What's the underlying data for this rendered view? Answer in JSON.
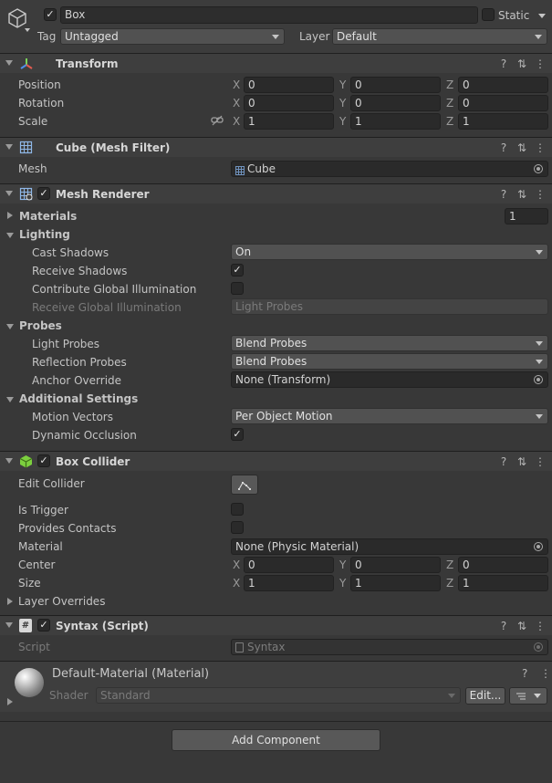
{
  "object": {
    "name": "Box",
    "static_label": "Static",
    "tag_label": "Tag",
    "tag_value": "Untagged",
    "layer_label": "Layer",
    "layer_value": "Default",
    "active": true
  },
  "transform": {
    "title": "Transform",
    "rows": [
      {
        "label": "Position",
        "x": "0",
        "y": "0",
        "z": "0"
      },
      {
        "label": "Rotation",
        "x": "0",
        "y": "0",
        "z": "0"
      },
      {
        "label": "Scale",
        "x": "1",
        "y": "1",
        "z": "1"
      }
    ],
    "axes": [
      "X",
      "Y",
      "Z"
    ]
  },
  "mesh_filter": {
    "title": "Cube (Mesh Filter)",
    "mesh_label": "Mesh",
    "mesh_value": "Cube"
  },
  "mesh_renderer": {
    "title": "Mesh Renderer",
    "enabled": true,
    "materials_label": "Materials",
    "materials_count": "1",
    "lighting_label": "Lighting",
    "cast_shadows_label": "Cast Shadows",
    "cast_shadows_value": "On",
    "receive_shadows_label": "Receive Shadows",
    "receive_shadows": true,
    "contribute_gi_label": "Contribute Global Illumination",
    "contribute_gi": false,
    "receive_gi_label": "Receive Global Illumination",
    "receive_gi_value": "Light Probes",
    "probes_label": "Probes",
    "light_probes_label": "Light Probes",
    "light_probes_value": "Blend Probes",
    "reflection_probes_label": "Reflection Probes",
    "reflection_probes_value": "Blend Probes",
    "anchor_override_label": "Anchor Override",
    "anchor_override_value": "None (Transform)",
    "additional_label": "Additional Settings",
    "motion_vectors_label": "Motion Vectors",
    "motion_vectors_value": "Per Object Motion",
    "dynamic_occlusion_label": "Dynamic Occlusion",
    "dynamic_occlusion": true
  },
  "box_collider": {
    "title": "Box Collider",
    "enabled": true,
    "edit_collider_label": "Edit Collider",
    "is_trigger_label": "Is Trigger",
    "is_trigger": false,
    "provides_contacts_label": "Provides Contacts",
    "provides_contacts": false,
    "material_label": "Material",
    "material_value": "None (Physic Material)",
    "center": {
      "label": "Center",
      "x": "0",
      "y": "0",
      "z": "0"
    },
    "size": {
      "label": "Size",
      "x": "1",
      "y": "1",
      "z": "1"
    },
    "layer_overrides_label": "Layer Overrides"
  },
  "syntax_script": {
    "title": "Syntax (Script)",
    "enabled": true,
    "script_label": "Script",
    "script_value": "Syntax"
  },
  "material": {
    "title": "Default-Material (Material)",
    "shader_label": "Shader",
    "shader_value": "Standard",
    "edit_button": "Edit..."
  },
  "add_component_button": "Add Component",
  "icons": {
    "checkmark": "✓",
    "help": "?",
    "menu": "⋮",
    "presets": "⇅"
  }
}
